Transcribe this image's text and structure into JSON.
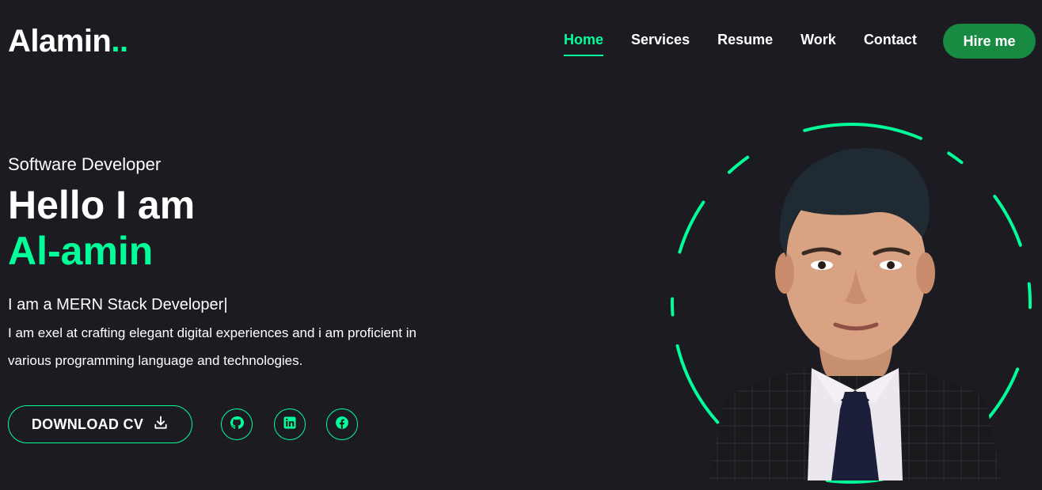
{
  "header": {
    "logo_text": "Alamin",
    "logo_dots": "..",
    "nav": [
      {
        "label": "Home",
        "active": true
      },
      {
        "label": "Services",
        "active": false
      },
      {
        "label": "Resume",
        "active": false
      },
      {
        "label": "Work",
        "active": false
      },
      {
        "label": "Contact",
        "active": false
      }
    ],
    "hire_label": "Hire me"
  },
  "hero": {
    "role": "Software Developer",
    "greeting": "Hello I am",
    "name": "Al-amin",
    "typed_text": "I am a MERN Stack Developer|",
    "description": "I am exel at crafting elegant digital experiences and i am proficient in various programming language and technologies.",
    "cv_label": "DOWNLOAD CV",
    "socials": [
      {
        "icon": "github-icon"
      },
      {
        "icon": "linkedin-icon"
      },
      {
        "icon": "facebook-icon"
      }
    ]
  },
  "colors": {
    "accent": "#00ff99",
    "background": "#1c1b22",
    "hire_button": "#188a42"
  }
}
